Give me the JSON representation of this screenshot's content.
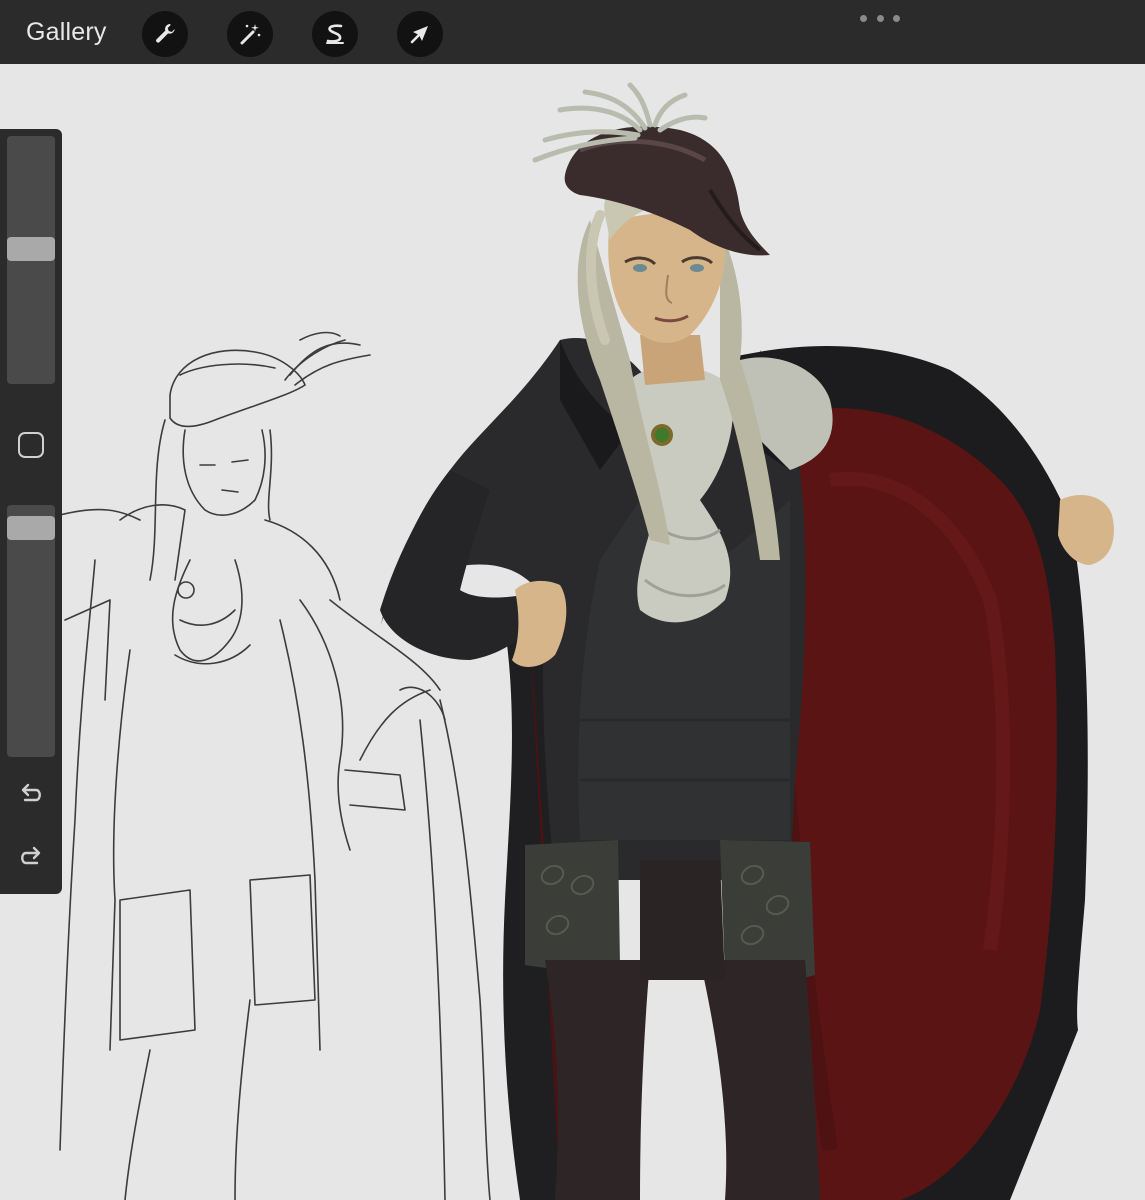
{
  "topbar": {
    "gallery_label": "Gallery",
    "tools": [
      {
        "name": "wrench-icon",
        "role": "actions"
      },
      {
        "name": "magic-wand-icon",
        "role": "adjustments"
      },
      {
        "name": "selection-s-icon",
        "role": "selection"
      },
      {
        "name": "arrow-cursor-icon",
        "role": "transform"
      }
    ],
    "more_icon": "ellipsis-icon"
  },
  "sidebar": {
    "brush_size_level": 0.55,
    "opacity_level": 0.95,
    "modify_icon": "square-icon",
    "undo_icon": "undo-icon",
    "redo_icon": "redo-icon"
  },
  "colors": {
    "toolbar_bg": "#2b2b2b",
    "button_bg": "#121212",
    "canvas_bg": "#e6e6e6",
    "coat": "#2a2a2c",
    "cape_lining": "#5a1414",
    "hat": "#3a2c2c",
    "hair": "#c9c6b2",
    "skin": "#d7b58a",
    "cravat": "#c9cbc0",
    "brooch": "#3e7a2a"
  }
}
